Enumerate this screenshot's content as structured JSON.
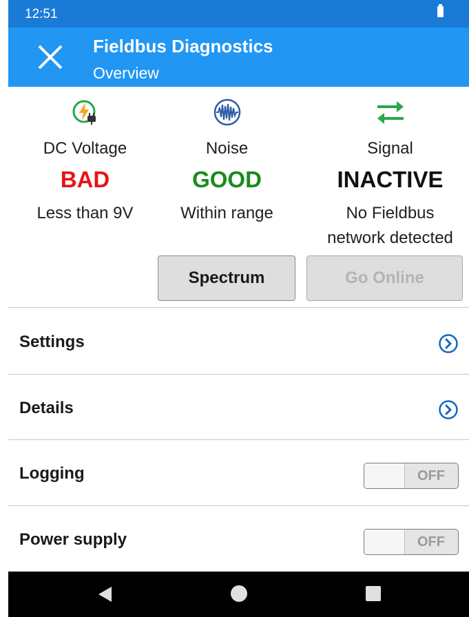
{
  "status_bar": {
    "time": "12:51",
    "battery_icon": "battery-icon"
  },
  "app_bar": {
    "title": "Fieldbus Diagnostics",
    "subtitle": "Overview",
    "close_icon": "close-icon"
  },
  "status": [
    {
      "icon": "dc-power-plug-icon",
      "label": "DC Voltage",
      "state": "BAD",
      "state_color": "#e81414",
      "detail": "Less than 9V"
    },
    {
      "icon": "noise-waveform-icon",
      "label": "Noise",
      "state": "GOOD",
      "state_color": "#1a8a1a",
      "detail": "Within range"
    },
    {
      "icon": "signal-arrows-icon",
      "label": "Signal",
      "state": "INACTIVE",
      "state_color": "#111111",
      "detail": "No Fieldbus network detected"
    }
  ],
  "actions": {
    "spectrum": "Spectrum",
    "go_online": "Go Online"
  },
  "rows": {
    "settings": {
      "label": "Settings",
      "icon": "chevron-right-circle-icon"
    },
    "details": {
      "label": "Details",
      "icon": "chevron-right-circle-icon"
    },
    "logging": {
      "label": "Logging",
      "toggle": "OFF"
    },
    "power_supply": {
      "label": "Power supply",
      "toggle": "OFF"
    }
  },
  "nav": {
    "back": "back-icon",
    "home": "home-icon",
    "recent": "recent-apps-icon"
  },
  "colors": {
    "status_bar": "#1a7bd6",
    "app_bar": "#2196f3",
    "accent_link": "#1565c0"
  }
}
